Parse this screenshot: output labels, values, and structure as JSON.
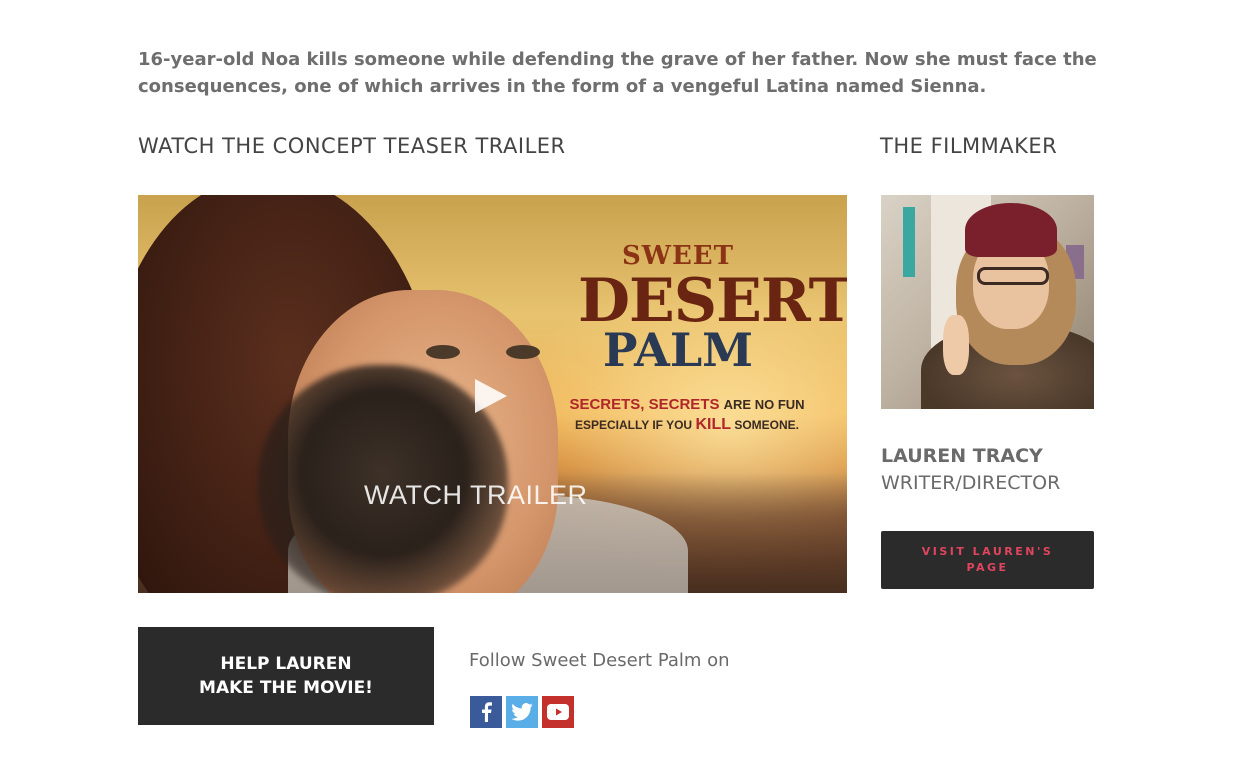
{
  "synopsis": "16-year-old Noa kills someone while defending the grave of her father. Now she must face the consequences, one of which arrives in the form of a vengeful Latina named Sienna.",
  "trailer_section": {
    "title": "WATCH THE CONCEPT TEASER TRAILER",
    "poster": {
      "logo_line1": "SWEET",
      "logo_line2": "DESERT",
      "logo_line3": "PALM",
      "tagline_red": "SECRETS, SECRETS",
      "tagline_rest1": "ARE NO FUN",
      "tagline_line2_a": "ESPECIALLY IF YOU",
      "tagline_kill": "KILL",
      "tagline_line2_b": "SOMEONE.",
      "watch_label": "WATCH TRAILER"
    }
  },
  "filmmaker_section": {
    "title": "THE FILMMAKER",
    "name": "LAUREN TRACY",
    "role": "WRITER/DIRECTOR",
    "visit_button": "VISIT LAUREN'S PAGE"
  },
  "cta": {
    "help_line1": "HELP LAUREN",
    "help_line2": "MAKE THE MOVIE!"
  },
  "follow": {
    "text": "Follow Sweet Desert Palm on",
    "icons": [
      "facebook-icon",
      "twitter-icon",
      "youtube-icon"
    ],
    "colors": {
      "facebook": "#3b5a9a",
      "twitter": "#5aaee8",
      "youtube": "#c4302b"
    }
  },
  "colors": {
    "accent": "#e0445e",
    "dark_button": "#2b2b2b"
  }
}
